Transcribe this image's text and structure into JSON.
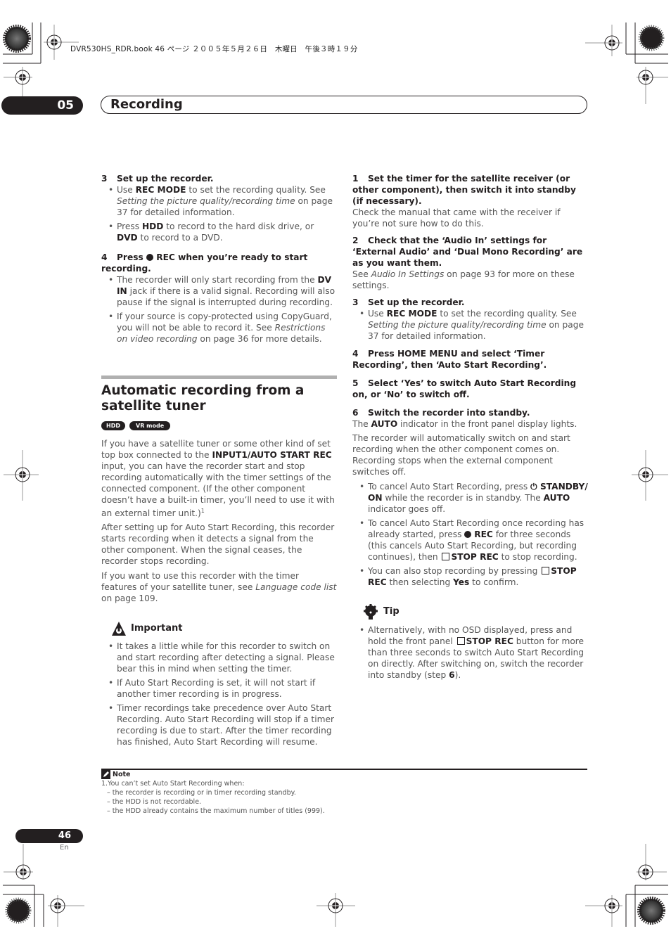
{
  "print_header": "DVR530HS_RDR.book  46 ページ  ２００５年５月２６日　木曜日　午後３時１９分",
  "chapter": {
    "number": "05",
    "title": "Recording"
  },
  "left_column": {
    "step3": {
      "num": "3",
      "title": "Set up the recorder."
    },
    "step3_bullets": [
      {
        "pre": "Use ",
        "b1": "REC MODE",
        "mid": " to set the recording quality. See ",
        "i1": "Setting the picture quality/recording time",
        "post": " on page 37 for detailed information."
      },
      {
        "pre": "Press ",
        "b1": "HDD",
        "mid": " to record to the hard disk drive, or ",
        "b2": "DVD",
        "post": " to record to a DVD."
      }
    ],
    "step4": {
      "num": "4",
      "title_pre": "Press ",
      "title_post": " REC when you’re ready to start recording."
    },
    "step4_bullets": [
      {
        "pre": "The recorder will only start recording from the ",
        "b1": "DV IN",
        "post": " jack if there is a valid signal. Recording will also pause if the signal is interrupted during recording."
      },
      {
        "pre": "If your source is copy-protected using CopyGuard, you will not be able to record it. See ",
        "i1": "Restrictions on video recording",
        "post": " on page 36 for more details."
      }
    ],
    "section_title": "Automatic recording from a satellite tuner",
    "badges": [
      "HDD",
      "VR mode"
    ],
    "para1": {
      "pre": "If you have a satellite tuner or some other kind of set top box connected to the ",
      "b1": "INPUT1/AUTO START REC",
      "post": " input, you can have the recorder start and stop recording automatically with the timer settings of the connected component. (If the other component doesn’t have a built-in timer, you’ll need to use it with an external timer unit.)",
      "footnote": "1"
    },
    "para2": "After setting up for Auto Start Recording, this recorder starts recording when it detects a signal from the other component. When the signal ceases, the recorder stops recording.",
    "para3": {
      "pre": "If you want to use this recorder with the timer features of your satellite tuner, see ",
      "i1": "Language code list",
      "post": " on page 109."
    },
    "important": {
      "heading": "Important",
      "bullets": [
        "It takes a little while for this recorder to switch on and start recording after detecting a signal. Please bear this in mind when setting the timer.",
        "If Auto Start Recording is set, it will not start if another timer recording is in progress.",
        "Timer recordings take precedence over Auto Start Recording. Auto Start Recording will stop if a timer recording is due to start. After the timer recording has finished, Auto Start Recording will resume."
      ]
    }
  },
  "right_column": {
    "step1": {
      "num": "1",
      "title": "Set the timer for the satellite receiver (or other component), then switch it into standby (if necessary).",
      "body": "Check the manual that came with the receiver if you’re not sure how to do this."
    },
    "step2": {
      "num": "2",
      "title": "Check that the ‘Audio In’ settings for ‘External Audio’ and ‘Dual Mono Recording’ are as you want them.",
      "body_pre": "See ",
      "body_i": "Audio In Settings",
      "body_post": " on page 93 for more on these settings."
    },
    "step3": {
      "num": "3",
      "title": "Set up the recorder.",
      "bullet": {
        "pre": "Use ",
        "b1": "REC MODE",
        "mid": " to set the recording quality. See ",
        "i1": "Setting the picture quality/recording time",
        "post": " on page 37 for detailed information."
      }
    },
    "step4": {
      "num": "4",
      "title": "Press HOME MENU and select ‘Timer Recording’, then ‘Auto Start Recording’."
    },
    "step5": {
      "num": "5",
      "title": "Select ‘Yes’ to switch Auto Start Recording on, or ‘No’ to switch off."
    },
    "step6": {
      "num": "6",
      "title": "Switch the recorder into standby.",
      "body_pre": "The ",
      "body_b": "AUTO",
      "body_post": " indicator in the front panel display lights."
    },
    "para": "The recorder will automatically switch on and start recording when the other component comes on. Recording stops when the external component switches off.",
    "bullets": {
      "b1": {
        "pre": "To cancel Auto Start Recording, press ",
        "b1": "STANDBY/ ON",
        "mid": " while the recorder is in standby. The ",
        "b2": "AUTO",
        "post": " indicator goes off."
      },
      "b2": {
        "pre": "To cancel Auto Start Recording once recording has already started, press ",
        "b1": "REC",
        "mid": " for three seconds (this cancels Auto Start Recording, but recording continues), then ",
        "b2": "STOP REC",
        "post": " to stop recording."
      },
      "b3": {
        "pre": "You can also stop recording by pressing ",
        "b1": "STOP REC",
        "mid": " then selecting ",
        "b2": "Yes",
        "post": " to confirm."
      }
    },
    "tip": {
      "heading": "Tip",
      "bullet": {
        "pre": "Alternatively, with no OSD displayed, press and hold the front panel ",
        "b1": "STOP REC",
        "mid": " button for more than three seconds to switch Auto Start Recording on directly. After switching on, switch the recorder into standby (step ",
        "b2": "6",
        "post": ")."
      }
    }
  },
  "note": {
    "heading": "Note",
    "lines": [
      "1.You can’t set Auto Start Recording when:",
      "– the recorder is recording or in timer recording standby.",
      "– the HDD is not recordable.",
      "– the HDD already contains the maximum number of titles (999)."
    ]
  },
  "footer": {
    "page_number": "46",
    "language": "En"
  }
}
